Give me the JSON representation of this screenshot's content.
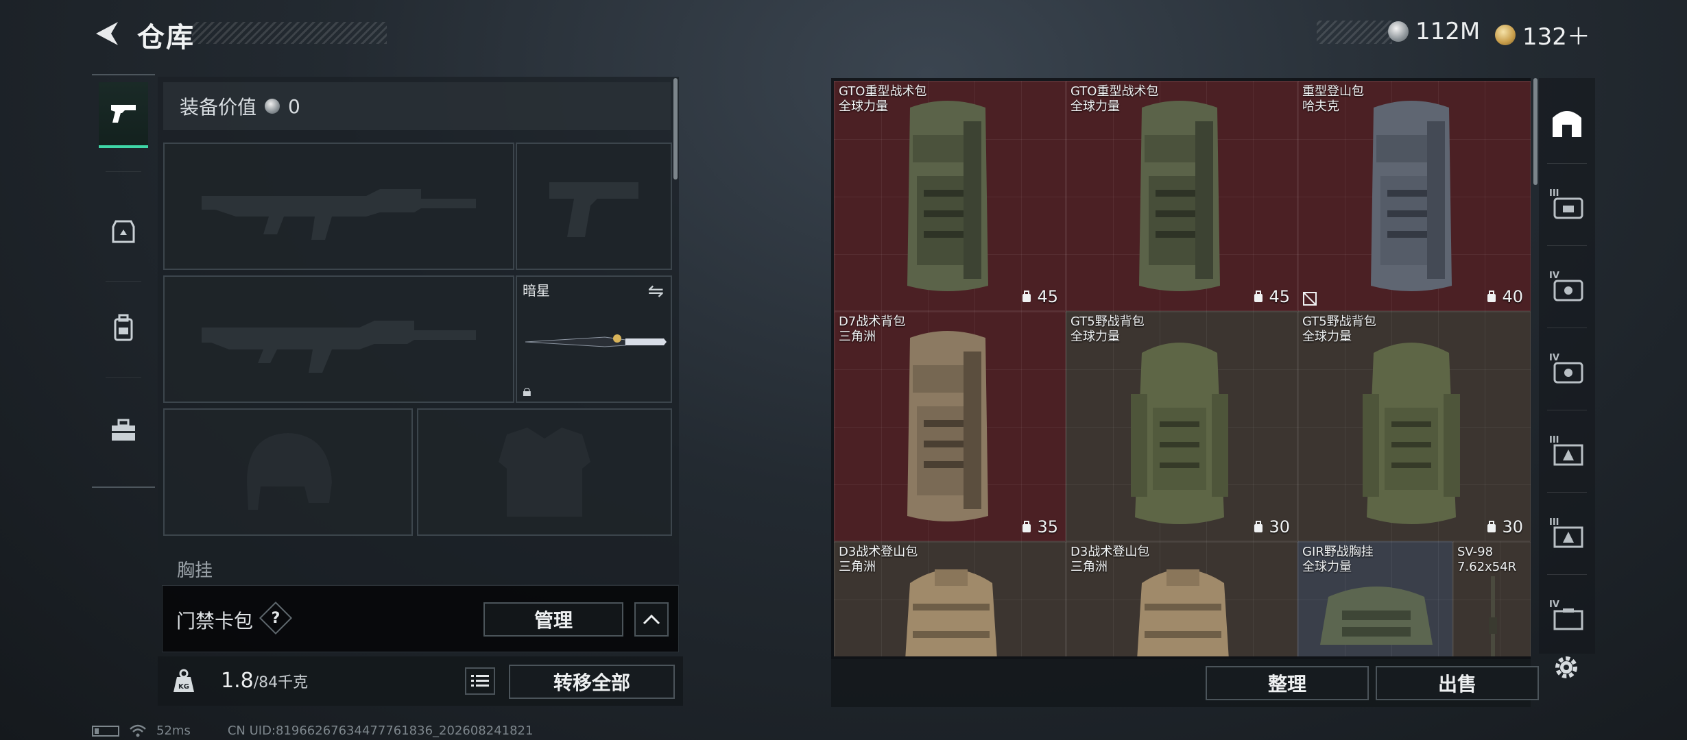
{
  "header": {
    "title": "仓库",
    "currencies": [
      {
        "icon": "silver-coin-icon",
        "value": "112M"
      },
      {
        "icon": "gold-coin-icon",
        "value": "132＋"
      }
    ]
  },
  "left_rail": {
    "items": [
      {
        "icon": "pistol-icon",
        "active": true
      },
      {
        "icon": "armor-icon",
        "active": false
      },
      {
        "icon": "backpack-icon",
        "active": false
      },
      {
        "icon": "toolbox-icon",
        "active": false
      }
    ]
  },
  "loadout": {
    "equip_value_label": "装备价值",
    "equip_value": "0",
    "melee_name": "暗星",
    "chest_label": "胸挂"
  },
  "access_card": {
    "label": "门禁卡包",
    "help": "?",
    "manage_label": "管理"
  },
  "weight": {
    "current": "1.8",
    "max": "/84千克",
    "transfer_label": "转移全部"
  },
  "stash": {
    "items": [
      {
        "name": "GTO重型战术包",
        "maker": "全球力量",
        "capacity": "45",
        "bg": "red"
      },
      {
        "name": "GTO重型战术包",
        "maker": "全球力量",
        "capacity": "45",
        "bg": "red"
      },
      {
        "name": "重型登山包",
        "maker": "哈夫克",
        "capacity": "40",
        "bg": "red"
      },
      {
        "name": "D7战术背包",
        "maker": "三角洲",
        "capacity": "35",
        "bg": "red"
      },
      {
        "name": "GT5野战背包",
        "maker": "全球力量",
        "capacity": "30",
        "bg": "brown"
      },
      {
        "name": "GT5野战背包",
        "maker": "全球力量",
        "capacity": "30",
        "bg": "brown"
      },
      {
        "name": "D3战术登山包",
        "maker": "三角洲",
        "capacity": "",
        "bg": "brown"
      },
      {
        "name": "D3战术登山包",
        "maker": "三角洲",
        "capacity": "",
        "bg": "brown"
      },
      {
        "name": "GIR野战胸挂",
        "maker": "全球力量",
        "capacity": "",
        "bg": "gray"
      },
      {
        "name": "SV-98",
        "maker": "7.62x54R",
        "capacity": "",
        "bg": "brown"
      }
    ],
    "sort_label": "整理",
    "sell_label": "出售"
  },
  "filter_rail": {
    "items": [
      {
        "icon": "all-items-icon",
        "tier": ""
      },
      {
        "icon": "tier3-backpack-icon",
        "tier": "III"
      },
      {
        "icon": "tier4-backpack-icon",
        "tier": "IV"
      },
      {
        "icon": "tier4-backpack-icon",
        "tier": "IV"
      },
      {
        "icon": "tier3-vest-icon",
        "tier": "III"
      },
      {
        "icon": "tier3-vest-icon",
        "tier": "III"
      },
      {
        "icon": "tier4-case-icon",
        "tier": "IV"
      }
    ]
  },
  "status_bar": {
    "ping": "52ms",
    "uid": "CN UID:81966267634477761836_202608241821"
  },
  "colors": {
    "accent": "#3fd6a6",
    "red_bg": "#4b2024",
    "brown_bg": "#3c3530"
  }
}
